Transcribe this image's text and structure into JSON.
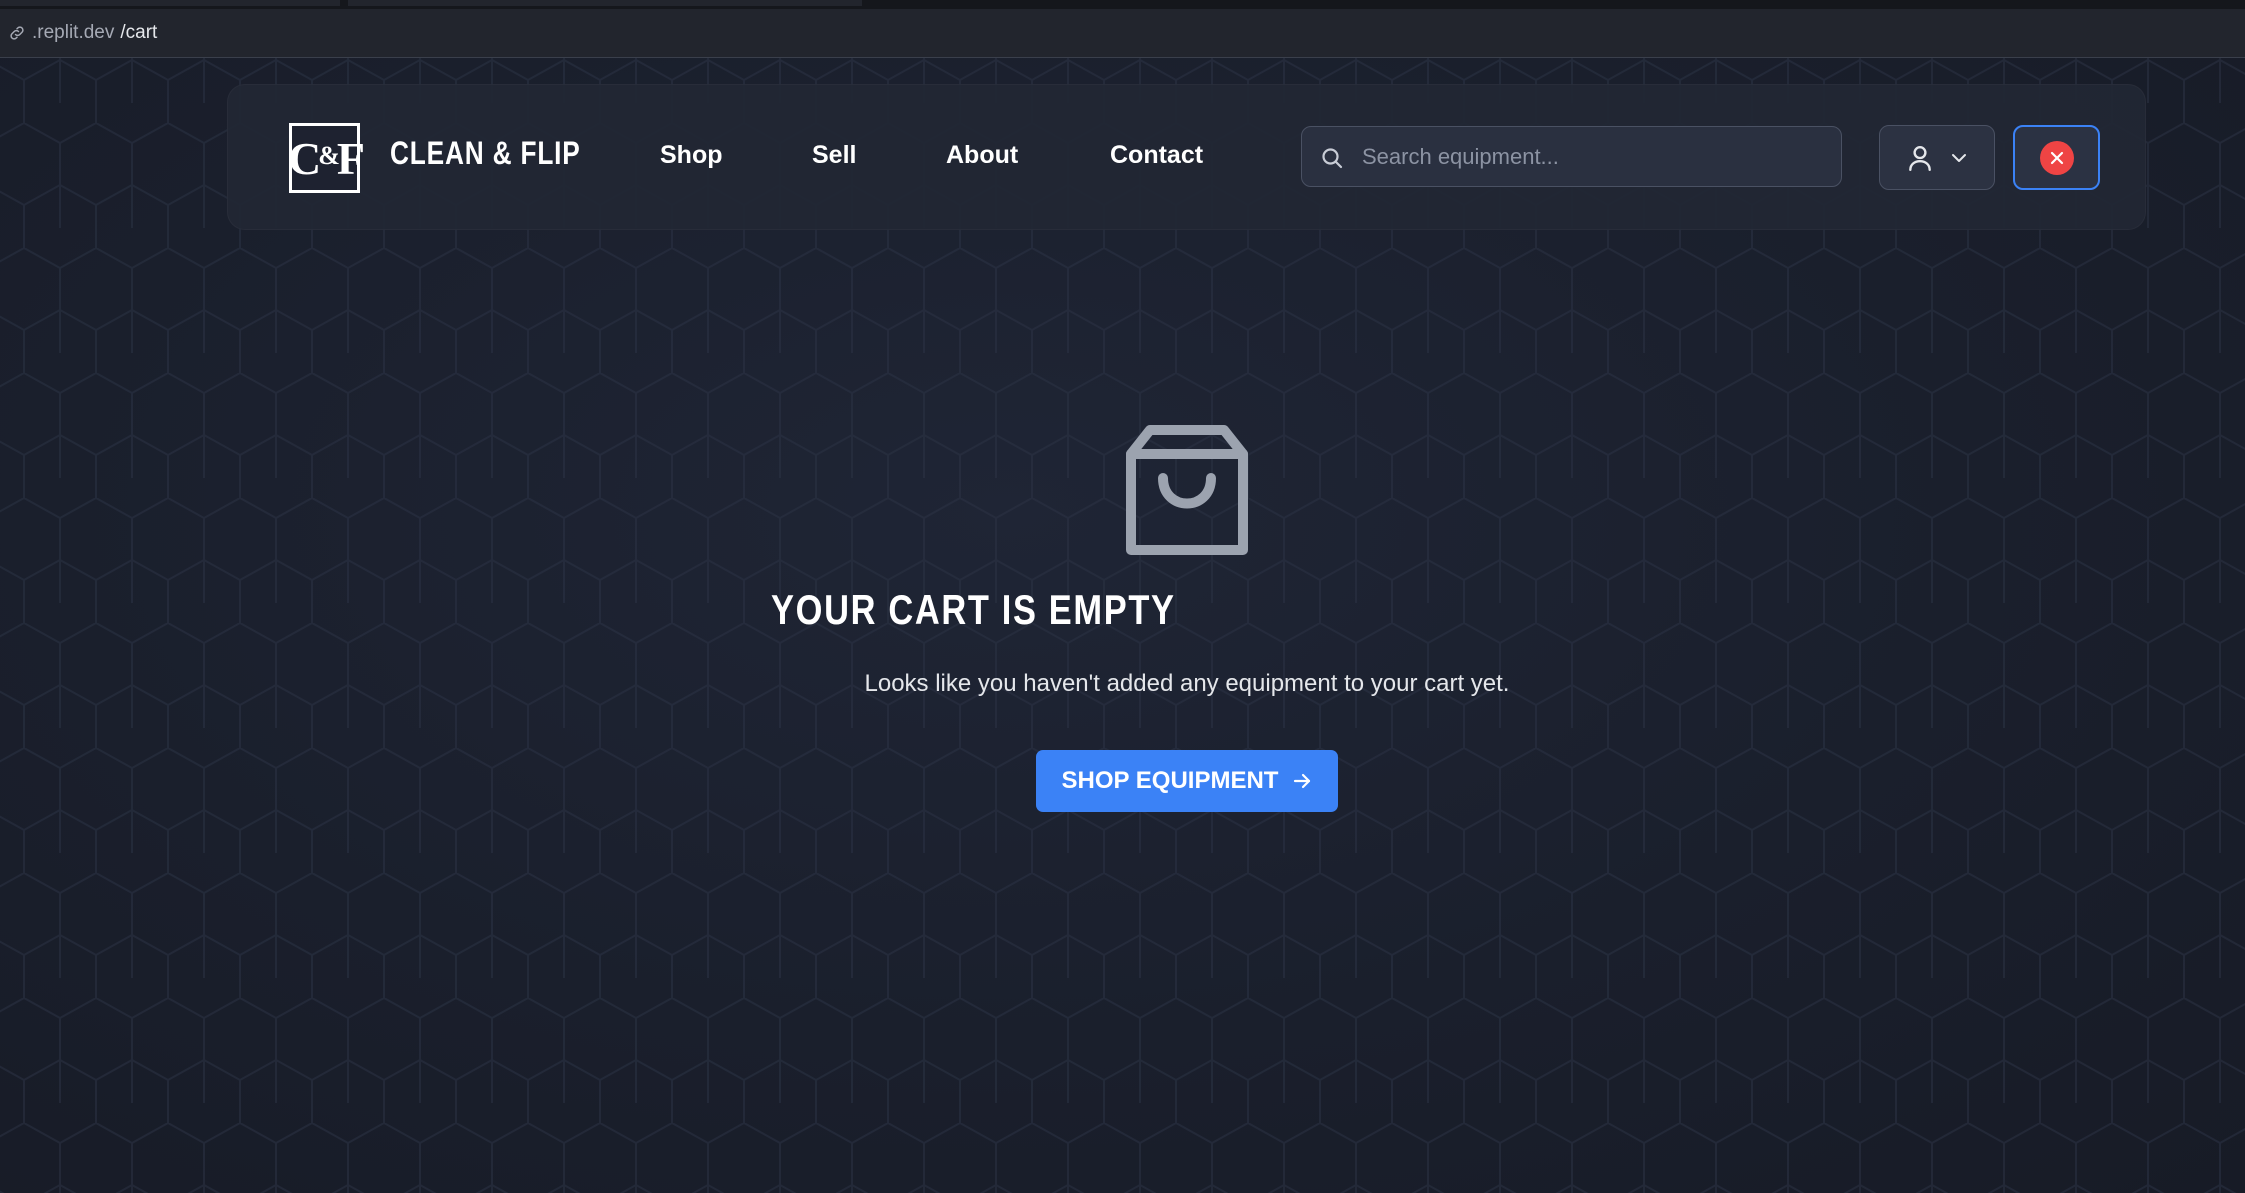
{
  "browser": {
    "url_host": ".replit.dev",
    "url_path": "/cart"
  },
  "header": {
    "logo_text_c": "C",
    "logo_text_amp": "&",
    "logo_text_f": "F",
    "brand": "CLEAN & FLIP",
    "nav": [
      {
        "label": "Shop"
      },
      {
        "label": "Sell"
      },
      {
        "label": "About"
      },
      {
        "label": "Contact"
      }
    ],
    "search": {
      "placeholder": "Search equipment...",
      "value": ""
    }
  },
  "icons": {
    "link": "link-icon",
    "search": "search-icon",
    "user": "user-icon",
    "chevron": "chevron-down-icon",
    "close": "close-icon",
    "bag": "shopping-bag-icon",
    "arrow": "arrow-right-icon"
  },
  "colors": {
    "accent": "#3b82f6",
    "danger": "#ef4444",
    "background": "#1b2030",
    "icon_gray": "#9ca3af"
  },
  "cart": {
    "title": "YOUR CART IS EMPTY",
    "message": "Looks like you haven't added any equipment to your cart yet.",
    "cta_label": "SHOP EQUIPMENT"
  }
}
